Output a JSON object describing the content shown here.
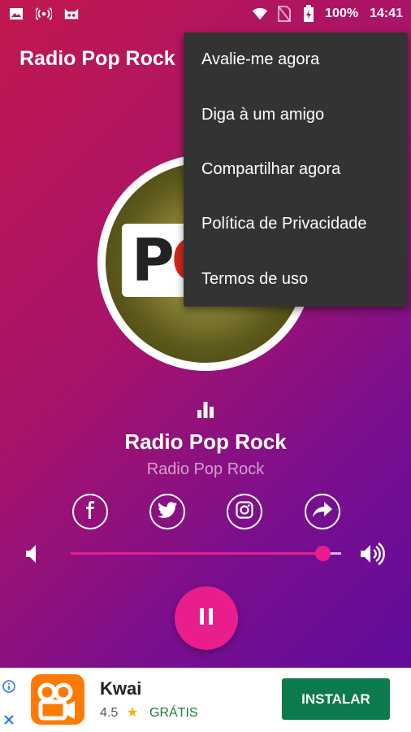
{
  "status_bar": {
    "battery": "100%",
    "time": "14:41"
  },
  "app": {
    "title": "Radio Pop Rock"
  },
  "menu": {
    "items": [
      "Avalie-me agora",
      "Diga à um amigo",
      "Compartilhar agora",
      "Política de Privacidade",
      "Termos de uso"
    ]
  },
  "album": {
    "logo_text_1": "P",
    "logo_text_2": "O"
  },
  "player": {
    "station_name": "Radio Pop Rock",
    "station_subtitle": "Radio Pop Rock",
    "volume_level": 0.93,
    "state": "playing"
  },
  "social": {
    "icons": [
      "facebook-icon",
      "twitter-icon",
      "instagram-icon",
      "share-icon"
    ]
  },
  "ad": {
    "app_name": "Kwai",
    "rating": "4.5",
    "price": "GRÁTIS",
    "button_label": "INSTALAR"
  },
  "colors": {
    "accent": "#e91e8c",
    "menu_bg": "#333333",
    "ad_button": "#0d7a4c"
  }
}
